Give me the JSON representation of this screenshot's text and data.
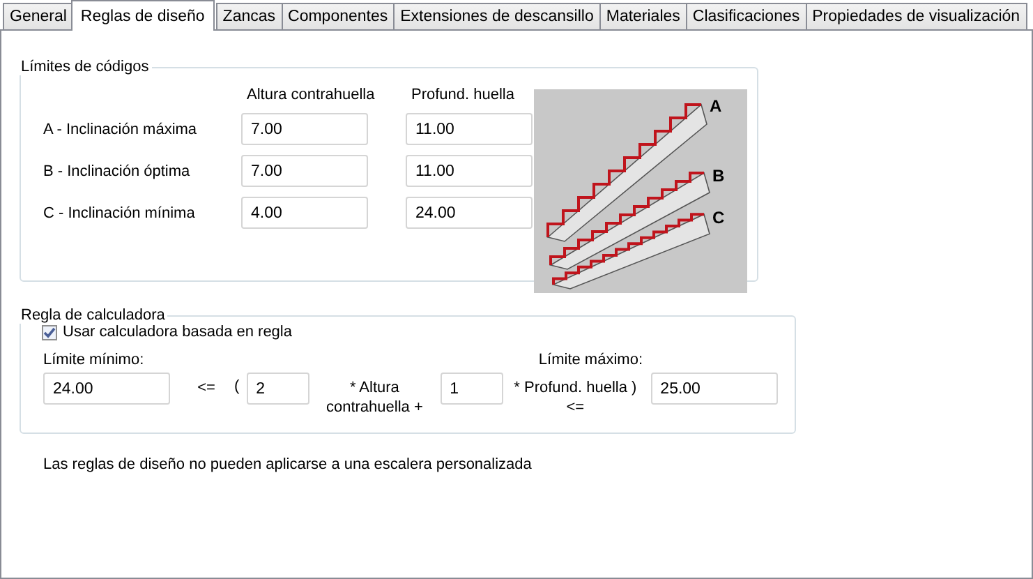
{
  "tabs": [
    {
      "label": "General",
      "selected": false
    },
    {
      "label": "Reglas de diseño",
      "selected": true
    },
    {
      "label": "Zancas",
      "selected": false
    },
    {
      "label": "Componentes",
      "selected": false
    },
    {
      "label": "Extensiones de descansillo",
      "selected": false
    },
    {
      "label": "Materiales",
      "selected": false
    },
    {
      "label": "Clasificaciones",
      "selected": false
    },
    {
      "label": "Propiedades de visualización",
      "selected": false
    }
  ],
  "code_limits": {
    "title": "Límites de códigos",
    "headers": [
      "Altura contrahuella",
      "Profund. huella"
    ],
    "rows": [
      {
        "label": "A - Inclinación máxima",
        "riser": "7.00",
        "tread": "11.00"
      },
      {
        "label": "B - Inclinación óptima",
        "riser": "7.00",
        "tread": "11.00"
      },
      {
        "label": "C - Inclinación mínima",
        "riser": "4.00",
        "tread": "24.00"
      }
    ],
    "diagram_labels": [
      "A",
      "B",
      "C"
    ]
  },
  "calculator_rule": {
    "title": "Regla de calculadora",
    "use_calculator": {
      "label": "Usar calculadora basada en regla",
      "checked": true
    },
    "min_label": "Límite mínimo:",
    "max_label": "Límite máximo:",
    "min_value": "24.00",
    "lte": "<=",
    "open_paren": "(",
    "riser_factor": "2",
    "riser_text": "* Altura contrahuella +",
    "tread_factor": "1",
    "tread_text": "* Profund. huella ) <=",
    "max_value": "25.00"
  },
  "note": "Las reglas de diseño no pueden aplicarse a una escalera personalizada"
}
